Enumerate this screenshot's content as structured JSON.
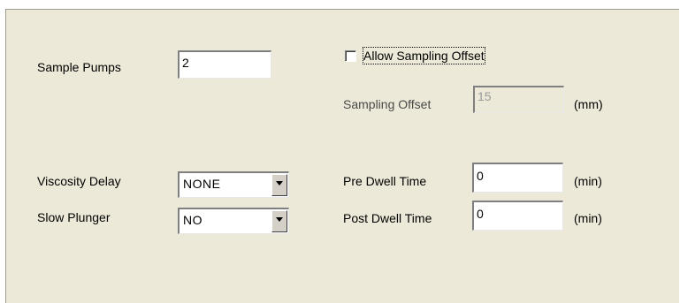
{
  "sample_pumps": {
    "label": "Sample Pumps",
    "value": "2"
  },
  "allow_sampling_offset": {
    "label": "Allow Sampling Offset",
    "checked": false
  },
  "sampling_offset": {
    "label": "Sampling Offset",
    "value": "15",
    "unit": "(mm)",
    "disabled": true
  },
  "viscosity_delay": {
    "label": "Viscosity Delay",
    "value": "NONE"
  },
  "slow_plunger": {
    "label": "Slow Plunger",
    "value": "NO"
  },
  "pre_dwell_time": {
    "label": "Pre Dwell Time",
    "value": "0",
    "unit": "(min)"
  },
  "post_dwell_time": {
    "label": "Post Dwell Time",
    "value": "0",
    "unit": "(min)"
  },
  "colors": {
    "panel_background": "#ece9d8",
    "field_background": "#ffffff",
    "disabled_text": "#9a9a9a"
  },
  "icons": {
    "dropdown": "chevron-down-icon"
  }
}
